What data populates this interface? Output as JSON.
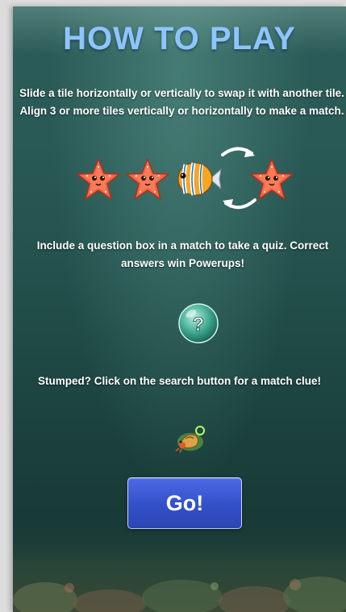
{
  "title": "HOW TO PLAY",
  "instructions": {
    "line1": "Slide a tile horizontally or vertically to swap it with another tile.",
    "line2": "Align 3 or more tiles vertically or horizontally to make a match.",
    "quiz": "Include a question box in a match to take a quiz. Correct answers win Powerups!",
    "clue": "Stumped? Click on the search button for a match clue!"
  },
  "question_mark": "?",
  "go_button": {
    "label": "Go!"
  },
  "icons": [
    "starfish-icon",
    "fish-icon",
    "swap-arrows-icon",
    "question-bubble-icon",
    "hermit-crab-icon"
  ],
  "colors": {
    "title": "#8fc5ff",
    "button": "#3350c8",
    "background": "#23504c"
  }
}
